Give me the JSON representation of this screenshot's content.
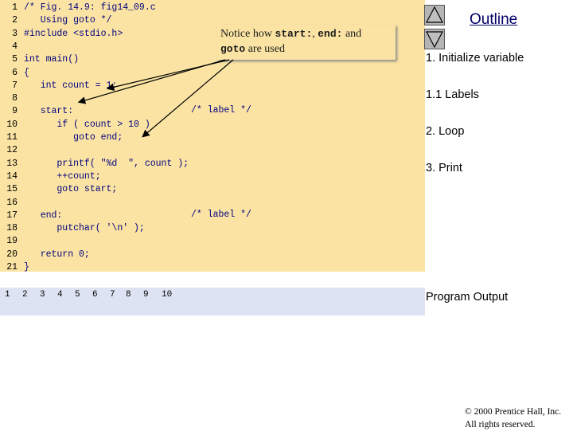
{
  "code": {
    "lines": [
      {
        "num": "1",
        "text": "/* Fig. 14.9: fig14_09.c"
      },
      {
        "num": "2",
        "text": "   Using goto */"
      },
      {
        "num": "3",
        "text": "#include <stdio.h>"
      },
      {
        "num": "4",
        "text": ""
      },
      {
        "num": "5",
        "text": "int main()"
      },
      {
        "num": "6",
        "text": "{"
      },
      {
        "num": "7",
        "text": "   int count = 1;"
      },
      {
        "num": "8",
        "text": ""
      },
      {
        "num": "9",
        "text": "   start:"
      },
      {
        "num": "10",
        "text": "      if ( count > 10 )"
      },
      {
        "num": "11",
        "text": "         goto end;"
      },
      {
        "num": "12",
        "text": ""
      },
      {
        "num": "13",
        "text": "      printf( \"%d  \", count );"
      },
      {
        "num": "14",
        "text": "      ++count;"
      },
      {
        "num": "15",
        "text": "      goto start;"
      },
      {
        "num": "16",
        "text": ""
      },
      {
        "num": "17",
        "text": "   end:"
      },
      {
        "num": "18",
        "text": "      putchar( '\\n' );"
      },
      {
        "num": "19",
        "text": ""
      },
      {
        "num": "20",
        "text": "   return 0;"
      },
      {
        "num": "21",
        "text": "}"
      }
    ],
    "label_comment_1": "/* label */",
    "label_comment_2": "/* label */"
  },
  "output": {
    "values": [
      "1",
      "2",
      "3",
      "4",
      "5",
      "6",
      "7",
      "8",
      "9",
      "10"
    ]
  },
  "callout": {
    "prefix": "Notice how ",
    "start_code": "start:",
    "comma": ", ",
    "end_code": "end:",
    "and": " and",
    "goto_code": "goto",
    "suffix": " are used"
  },
  "sidebar": {
    "title": "Outline",
    "items": [
      {
        "label": "1. Initialize variable"
      },
      {
        "label": "1.1 Labels"
      },
      {
        "label": "2. Loop"
      },
      {
        "label": "3. Print"
      },
      {
        "label": "Program Output"
      }
    ]
  },
  "footer": {
    "line1": "© 2000 Prentice Hall, Inc.",
    "line2": "All rights reserved."
  },
  "colors": {
    "code_bg": "#fbe4a3",
    "output_bg": "#dde3f2",
    "code_text": "#000080",
    "nav_btn": "#b5b5b5"
  },
  "icons": {
    "up": "triangle-up-icon",
    "down": "triangle-down-icon"
  }
}
